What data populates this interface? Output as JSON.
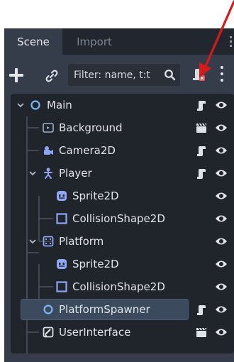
{
  "tabs": [
    {
      "label": "Scene",
      "active": true
    },
    {
      "label": "Import",
      "active": false
    }
  ],
  "toolbar": {
    "filter_placeholder": "Filter: name, t:t",
    "icons": [
      "plus-icon",
      "link-icon",
      "search-icon",
      "script-filter-icon",
      "more-vertical-icon"
    ]
  },
  "tree": {
    "nodes": [
      {
        "label": "Main",
        "icon": "node-circle-icon",
        "expanded": true,
        "script": true,
        "depth": 0
      },
      {
        "label": "Background",
        "icon": "parallax-background-icon",
        "script": false,
        "scene": true,
        "depth": 1
      },
      {
        "label": "Camera2D",
        "icon": "camera-icon",
        "script": true,
        "depth": 1
      },
      {
        "label": "Player",
        "icon": "character-body-icon",
        "expanded": true,
        "script": true,
        "depth": 1
      },
      {
        "label": "Sprite2D",
        "icon": "sprite-icon",
        "script": false,
        "depth": 2
      },
      {
        "label": "CollisionShape2D",
        "icon": "collision-shape-icon",
        "script": false,
        "depth": 2
      },
      {
        "label": "Platform",
        "icon": "static-body-icon",
        "expanded": true,
        "script": false,
        "depth": 1
      },
      {
        "label": "Sprite2D",
        "icon": "sprite-icon",
        "script": false,
        "depth": 2
      },
      {
        "label": "CollisionShape2D",
        "icon": "collision-shape-icon",
        "script": false,
        "depth": 2
      },
      {
        "label": "PlatformSpawner",
        "icon": "node-circle-icon",
        "script": true,
        "selected": true,
        "depth": 1
      },
      {
        "label": "UserInterface",
        "icon": "control-icon",
        "scene": true,
        "depth": 1
      }
    ]
  },
  "colors": {
    "panel_bg": "#363d4a",
    "tree_bg": "#20242b",
    "selection": "#3c4a5e",
    "node_blue": "#7ab6f5",
    "node2d_blue": "#8da5f3",
    "sprite_purple": "#8ea6f4",
    "annotation_red": "#d61a1a",
    "script_warn_red": "#e34b4b"
  }
}
